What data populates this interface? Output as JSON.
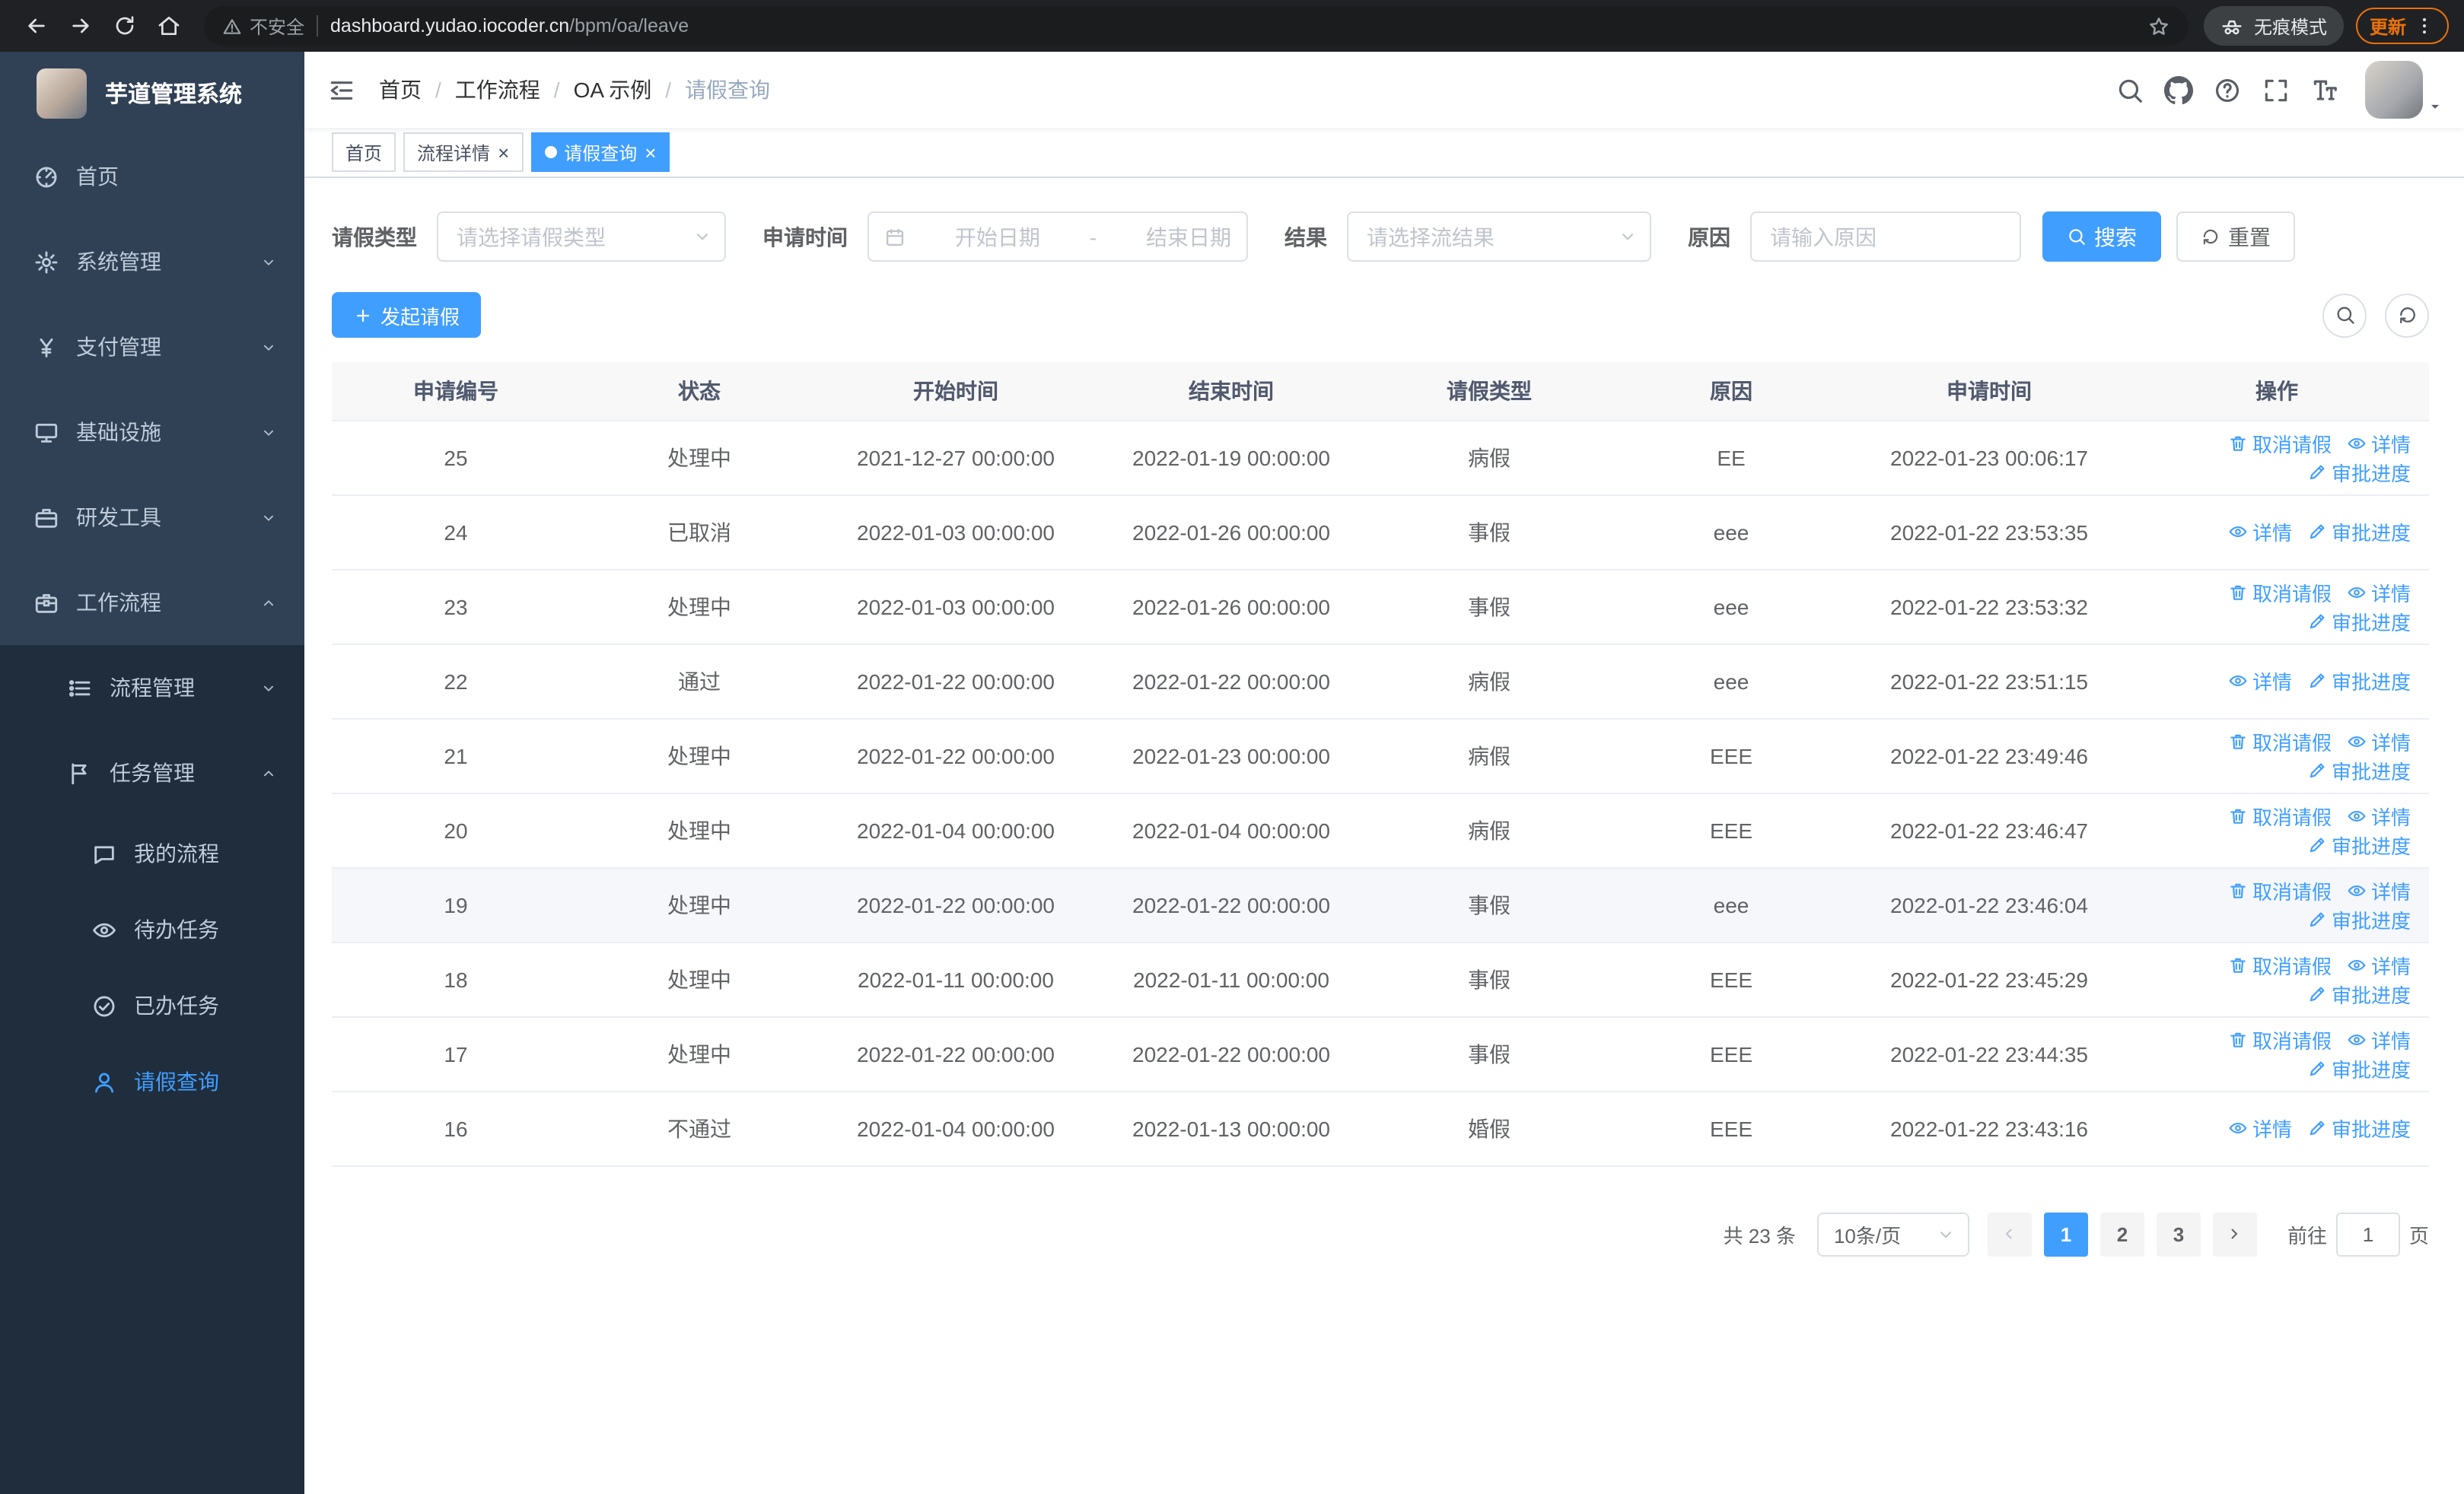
{
  "colors": {
    "accent": "#409eff",
    "sidebar": "#304156",
    "sidebar_sub": "#1f2d3d",
    "update_chip": "#e8710a"
  },
  "browser": {
    "security_label": "不安全",
    "url_domain": "dashboard.yudao.iocoder.cn",
    "url_path": "/bpm/oa/leave",
    "incognito_label": "无痕模式",
    "update_label": "更新"
  },
  "sidebar": {
    "logo_title": "芋道管理系统",
    "menu": [
      {
        "id": "home",
        "label": "首页",
        "icon": "dashboard-icon"
      },
      {
        "id": "system",
        "label": "系统管理",
        "icon": "gear-icon",
        "expandable": true
      },
      {
        "id": "payment",
        "label": "支付管理",
        "icon": "yen-icon",
        "expandable": true
      },
      {
        "id": "infrastructure",
        "label": "基础设施",
        "icon": "monitor-icon",
        "expandable": true
      },
      {
        "id": "dev-tools",
        "label": "研发工具",
        "icon": "toolbox-icon",
        "expandable": true
      },
      {
        "id": "workflow",
        "label": "工作流程",
        "icon": "briefcase-icon",
        "expandable": true,
        "expanded": true,
        "children": [
          {
            "id": "process-management",
            "label": "流程管理",
            "icon": "list-icon",
            "expandable": true
          },
          {
            "id": "task-management",
            "label": "任务管理",
            "icon": "flag-icon",
            "expandable": true,
            "expanded": true,
            "children": [
              {
                "id": "my-process",
                "label": "我的流程",
                "icon": "chat-icon"
              },
              {
                "id": "todo-tasks",
                "label": "待办任务",
                "icon": "eye-icon"
              },
              {
                "id": "done-tasks",
                "label": "已办任务",
                "icon": "check-circle-icon"
              },
              {
                "id": "leave-query",
                "label": "请假查询",
                "icon": "user-icon",
                "active": true
              }
            ]
          }
        ]
      }
    ]
  },
  "header": {
    "breadcrumb": [
      "首页",
      "工作流程",
      "OA 示例",
      "请假查询"
    ]
  },
  "tabs": [
    {
      "id": "home",
      "label": "首页",
      "closable": false,
      "active": false
    },
    {
      "id": "process-detail",
      "label": "流程详情",
      "closable": true,
      "active": false
    },
    {
      "id": "leave-query",
      "label": "请假查询",
      "closable": true,
      "active": true
    }
  ],
  "filters": {
    "leave_type_label": "请假类型",
    "leave_type_placeholder": "请选择请假类型",
    "apply_time_label": "申请时间",
    "date_start_placeholder": "开始日期",
    "date_separator": "-",
    "date_end_placeholder": "结束日期",
    "result_label": "结果",
    "result_placeholder": "请选择流结果",
    "reason_label": "原因",
    "reason_placeholder": "请输入原因",
    "search_button": "搜索",
    "reset_button": "重置"
  },
  "toolbar": {
    "create_button": "发起请假"
  },
  "table": {
    "columns": [
      "申请编号",
      "状态",
      "开始时间",
      "结束时间",
      "请假类型",
      "原因",
      "申请时间",
      "操作"
    ],
    "actions": {
      "cancel": "取消请假",
      "detail": "详情",
      "progress": "审批进度"
    },
    "rows": [
      {
        "id": "25",
        "status": "处理中",
        "start": "2021-12-27 00:00:00",
        "end": "2022-01-19 00:00:00",
        "type": "病假",
        "reason": "EE",
        "applied": "2022-01-23 00:06:17",
        "cancellable": true,
        "highlighted": false
      },
      {
        "id": "24",
        "status": "已取消",
        "start": "2022-01-03 00:00:00",
        "end": "2022-01-26 00:00:00",
        "type": "事假",
        "reason": "eee",
        "applied": "2022-01-22 23:53:35",
        "cancellable": false,
        "highlighted": false
      },
      {
        "id": "23",
        "status": "处理中",
        "start": "2022-01-03 00:00:00",
        "end": "2022-01-26 00:00:00",
        "type": "事假",
        "reason": "eee",
        "applied": "2022-01-22 23:53:32",
        "cancellable": true,
        "highlighted": false
      },
      {
        "id": "22",
        "status": "通过",
        "start": "2022-01-22 00:00:00",
        "end": "2022-01-22 00:00:00",
        "type": "病假",
        "reason": "eee",
        "applied": "2022-01-22 23:51:15",
        "cancellable": false,
        "highlighted": false
      },
      {
        "id": "21",
        "status": "处理中",
        "start": "2022-01-22 00:00:00",
        "end": "2022-01-23 00:00:00",
        "type": "病假",
        "reason": "EEE",
        "applied": "2022-01-22 23:49:46",
        "cancellable": true,
        "highlighted": false
      },
      {
        "id": "20",
        "status": "处理中",
        "start": "2022-01-04 00:00:00",
        "end": "2022-01-04 00:00:00",
        "type": "病假",
        "reason": "EEE",
        "applied": "2022-01-22 23:46:47",
        "cancellable": true,
        "highlighted": false
      },
      {
        "id": "19",
        "status": "处理中",
        "start": "2022-01-22 00:00:00",
        "end": "2022-01-22 00:00:00",
        "type": "事假",
        "reason": "eee",
        "applied": "2022-01-22 23:46:04",
        "cancellable": true,
        "highlighted": true
      },
      {
        "id": "18",
        "status": "处理中",
        "start": "2022-01-11 00:00:00",
        "end": "2022-01-11 00:00:00",
        "type": "事假",
        "reason": "EEE",
        "applied": "2022-01-22 23:45:29",
        "cancellable": true,
        "highlighted": false
      },
      {
        "id": "17",
        "status": "处理中",
        "start": "2022-01-22 00:00:00",
        "end": "2022-01-22 00:00:00",
        "type": "事假",
        "reason": "EEE",
        "applied": "2022-01-22 23:44:35",
        "cancellable": true,
        "highlighted": false
      },
      {
        "id": "16",
        "status": "不通过",
        "start": "2022-01-04 00:00:00",
        "end": "2022-01-13 00:00:00",
        "type": "婚假",
        "reason": "EEE",
        "applied": "2022-01-22 23:43:16",
        "cancellable": false,
        "highlighted": false
      }
    ]
  },
  "pagination": {
    "total_text": "共 23 条",
    "page_size": "10条/页",
    "pages": [
      "1",
      "2",
      "3"
    ],
    "current_page": "1",
    "goto_label": "前往",
    "goto_value": "1",
    "page_unit": "页"
  }
}
